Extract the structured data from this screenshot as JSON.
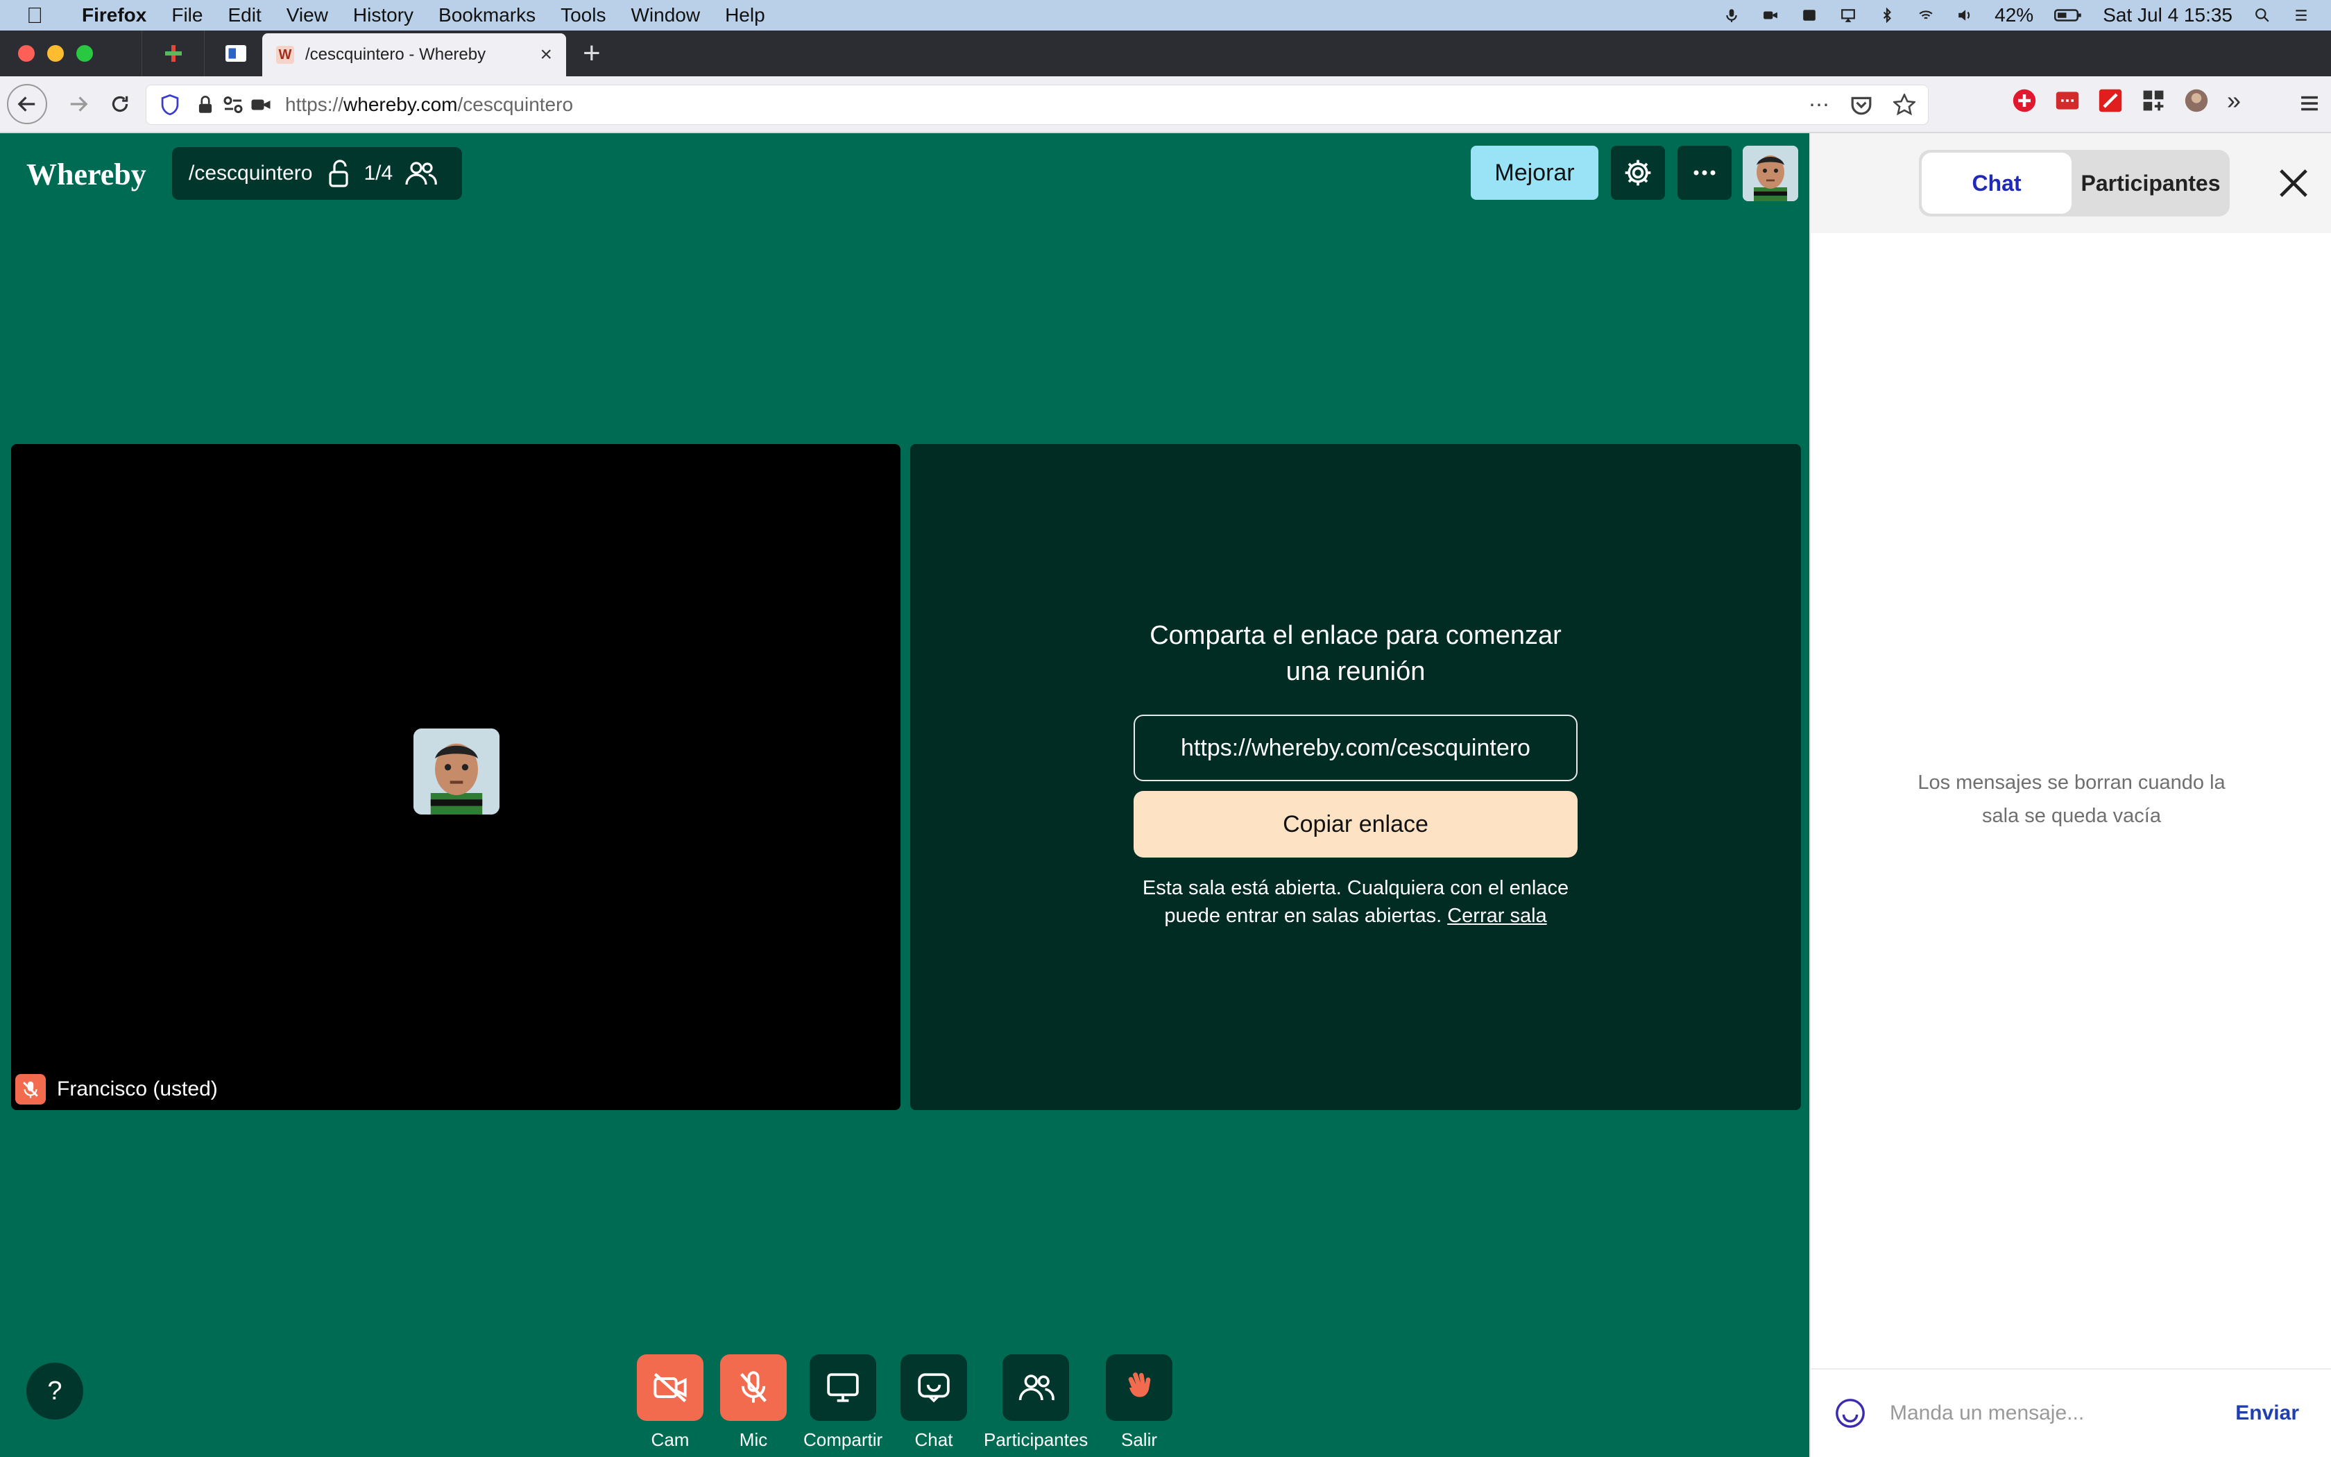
{
  "menubar": {
    "app": "Firefox",
    "items": [
      "File",
      "Edit",
      "View",
      "History",
      "Bookmarks",
      "Tools",
      "Window",
      "Help"
    ],
    "battery": "42%",
    "datetime": "Sat Jul 4  15:35"
  },
  "browser": {
    "tab_title": "/cescquintero - Whereby",
    "tab_favicon": "W",
    "url_prefix": "https://",
    "url_domain": "whereby.com",
    "url_path": "/cescquintero"
  },
  "whereby": {
    "logo": "Whereby",
    "room_name": "/cescquintero",
    "participant_count": "1/4",
    "upgrade_label": "Mejorar",
    "share_title_line1": "Comparta el enlace para comenzar",
    "share_title_line2": "una reunión",
    "share_link": "https://whereby.com/cescquintero",
    "copy_label": "Copiar enlace",
    "open_text_line1": "Esta sala está abierta. Cualquiera con el enlace",
    "open_text_line2": "puede entrar en salas abiertas.",
    "close_room_link": "Cerrar sala",
    "self_name": "Francisco (usted)",
    "help_label": "?",
    "toolbar": {
      "cam": "Cam",
      "mic": "Mic",
      "share": "Compartir",
      "chat": "Chat",
      "participants": "Participantes",
      "leave": "Salir"
    }
  },
  "panel": {
    "tab_chat": "Chat",
    "tab_participants": "Participantes",
    "empty_line1": "Los mensajes se borran cuando la",
    "empty_line2": "sala se queda vacía",
    "input_placeholder": "Manda un mensaje...",
    "send_label": "Enviar"
  },
  "colors": {
    "room_bg": "#006b53",
    "dark_green": "#00362b",
    "accent_orange": "#f26b4f",
    "upgrade_blue": "#9ae2f5",
    "copy_peach": "#fde3c4",
    "chat_blue": "#1f2bb8"
  }
}
